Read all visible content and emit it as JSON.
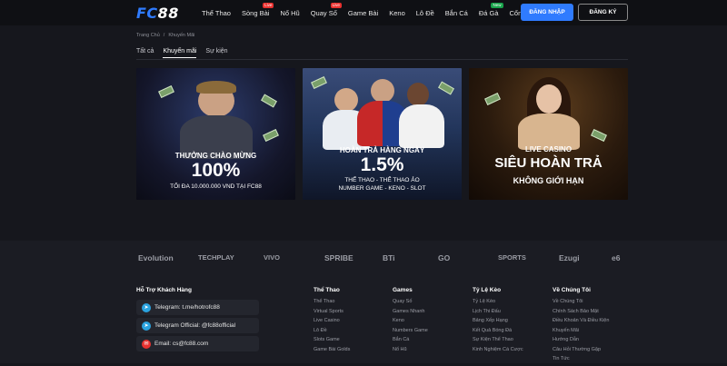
{
  "header": {
    "logo_text": "FC",
    "logo_num": "88",
    "nav": [
      {
        "label": "Thể Thao",
        "badge": ""
      },
      {
        "label": "Sòng Bài",
        "badge": "Live"
      },
      {
        "label": "Nổ Hũ",
        "badge": ""
      },
      {
        "label": "Quay Số",
        "badge": "Live"
      },
      {
        "label": "Game Bài",
        "badge": ""
      },
      {
        "label": "Keno",
        "badge": ""
      },
      {
        "label": "Lô Đề",
        "badge": ""
      },
      {
        "label": "Bắn Cá",
        "badge": ""
      },
      {
        "label": "Đá Gà",
        "badge": "New"
      },
      {
        "label": "Cổng Game",
        "badge": ""
      }
    ],
    "login_label": "ĐĂNG NHẬP",
    "register_label": "ĐĂNG KÝ"
  },
  "breadcrumb": {
    "home": "Trang Chủ",
    "sep": "/",
    "current": "Khuyến Mãi"
  },
  "tabs": [
    {
      "label": "Tất cả"
    },
    {
      "label": "Khuyến mãi"
    },
    {
      "label": "Sự kiện"
    }
  ],
  "banners": [
    {
      "line1": "THƯỞNG CHÀO MỪNG",
      "line2": "100%",
      "line3": "TỐI ĐA 10.000.000 VND TẠI FC88",
      "line4": ""
    },
    {
      "line1": "HOÀN TRẢ HÀNG NGÀY",
      "line2": "1.5%",
      "line3": "THỂ THAO - THỂ THAO ẢO",
      "line4": "NUMBER GAME - KENO - SLOT"
    },
    {
      "line1": "LIVE CASINO",
      "line2": "SIÊU HOÀN TRẢ",
      "line3": "KHÔNG GIỚI HẠN",
      "line4": ""
    }
  ],
  "partners": [
    "Evolution",
    "TECHPLAY",
    "VIVO",
    "SPRIBE",
    "BTi",
    "GO",
    "SPORTS",
    "Ezugi",
    "e6"
  ],
  "support": {
    "title": "Hỗ Trợ Khách Hàng",
    "items": [
      {
        "icon": "telegram-icon",
        "text": "Telegram: t.me/hotrofc88",
        "color": "#2aa3e0"
      },
      {
        "icon": "telegram-icon",
        "text": "Telegram Official: @fc88official",
        "color": "#2aa3e0"
      },
      {
        "icon": "email-icon",
        "text": "Email: cs@fc88.com",
        "color": "#e8312f"
      }
    ]
  },
  "columns": [
    {
      "title": "Thể Thao",
      "links": [
        "Thể Thao",
        "Virtual Sports",
        "Live Casino",
        "Lô Đề",
        "Slots Game",
        "Game Bài Golds"
      ]
    },
    {
      "title": "Games",
      "links": [
        "Quay Số",
        "Games Nhanh",
        "Keno",
        "Numbers Game",
        "Bắn Cá",
        "Nổ Hũ"
      ]
    },
    {
      "title": "Tỷ Lệ Kèo",
      "links": [
        "Tỷ Lệ Kèo",
        "Lịch Thi Đấu",
        "Bảng Xếp Hạng",
        "Kết Quả Bóng Đá",
        "Sự Kiện Thể Thao",
        "Kinh Nghiệm Cá Cược"
      ]
    },
    {
      "title": "Về Chúng Tôi",
      "links": [
        "Về Chúng Tôi",
        "Chính Sách Bảo Mật",
        "Điều Khoản Và Điều Kiện",
        "Khuyến Mãi",
        "Hướng Dẫn",
        "Câu Hỏi Thường Gặp",
        "Tin Tức"
      ]
    }
  ]
}
